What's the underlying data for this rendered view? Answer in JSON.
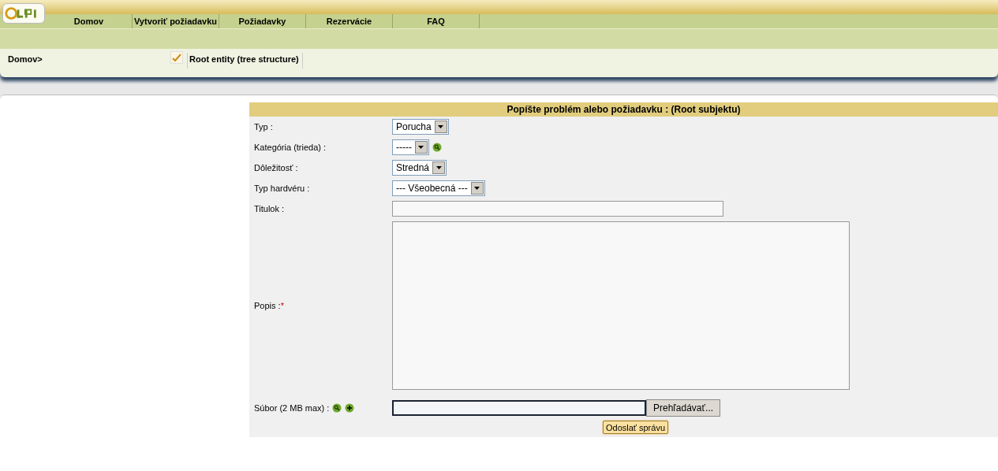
{
  "nav": {
    "items": [
      {
        "label": "Domov"
      },
      {
        "label": "Vytvoriť požiadavku"
      },
      {
        "label": "Požiadavky"
      },
      {
        "label": "Rezervácie"
      },
      {
        "label": "FAQ"
      }
    ]
  },
  "breadcrumb": {
    "path": "Domov>",
    "entity": "Root entity (tree structure)"
  },
  "form": {
    "title": "Popíšte problém alebo požiadavku :  (Root subjektu)",
    "fields": [
      {
        "label": "Typ :",
        "kind": "select",
        "value": "Porucha"
      },
      {
        "label": "Kategória (trieda) :",
        "kind": "select",
        "value": "-----",
        "search_button": true
      },
      {
        "label": "Dôležitosť :",
        "kind": "select",
        "value": "Stredná"
      },
      {
        "label": "Typ hardvéru :",
        "kind": "select",
        "value": "--- Všeobecná ---"
      },
      {
        "label": "Titulok :",
        "kind": "text"
      },
      {
        "label": "Popis :",
        "required_mark": "*",
        "kind": "textarea"
      },
      {
        "label": "Súbor (2 MB max) :",
        "kind": "file",
        "browse": "Prehľadávať...",
        "search_button": true,
        "add_button": true
      }
    ],
    "submit": "Odoslať správu"
  }
}
